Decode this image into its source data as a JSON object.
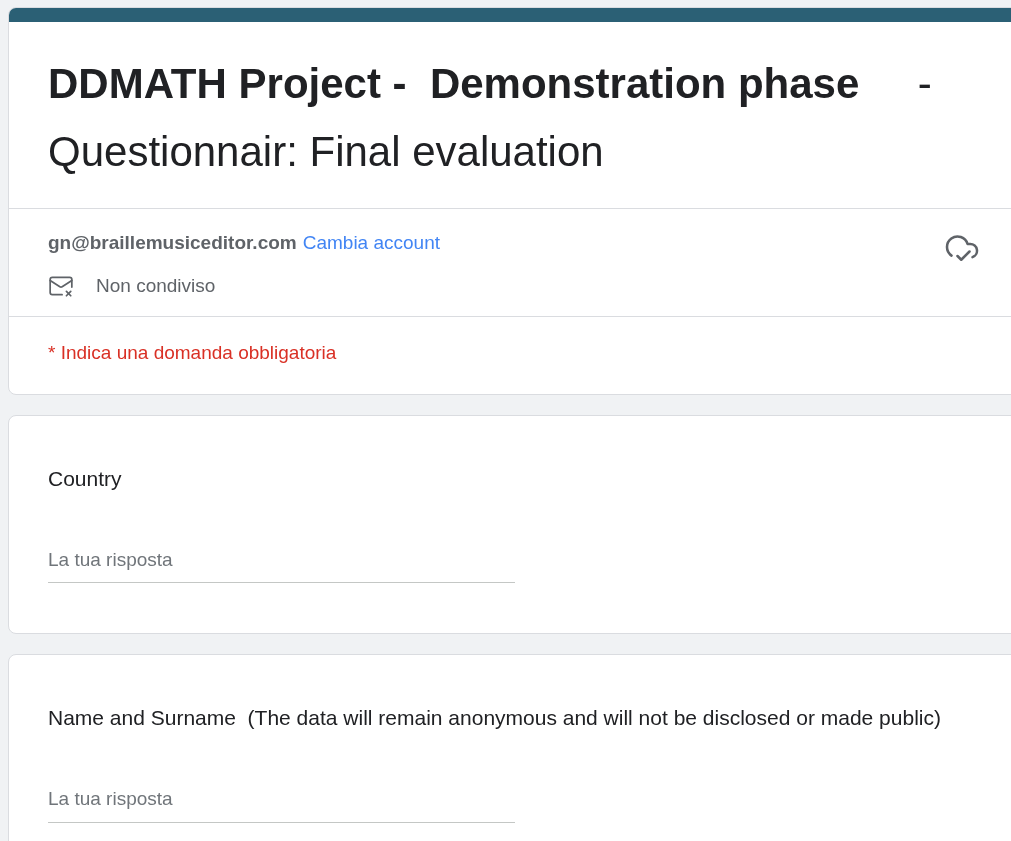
{
  "form": {
    "title": "**DDMATH Project -  Demonstration phase**     - Questionnair: Final evaluation",
    "account": {
      "email": "gn@braillemusiceditor.com",
      "switch_link": "Cambia account",
      "sharing": "Non condiviso"
    },
    "required_note": "* Indica una domanda obbligatoria"
  },
  "questions": [
    {
      "label": "Country",
      "placeholder": "La tua risposta"
    },
    {
      "label": "Name and Surname  (The data will remain anonymous and will not be disclosed or made public)",
      "placeholder": "La tua risposta"
    }
  ]
}
